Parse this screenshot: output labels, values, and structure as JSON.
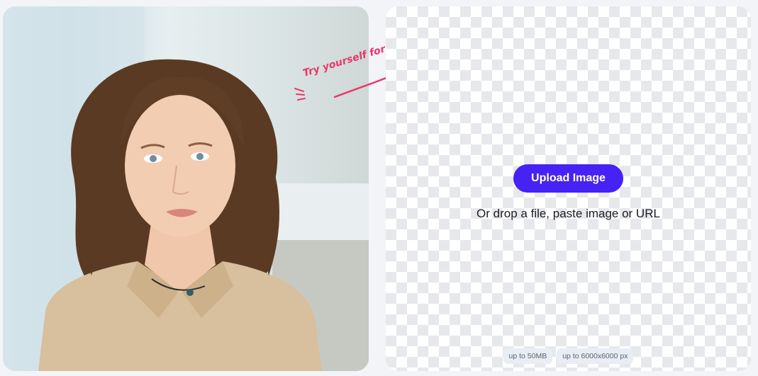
{
  "hero": {
    "photo_alt": "Portrait of a young woman with curly brown hair in a beige shirt",
    "annotation_text": "Try yourself for free"
  },
  "upload": {
    "button_label": "Upload Image",
    "drop_text": "Or drop a file, paste image or URL",
    "limits": [
      "up to 50MB",
      "up to 6000x6000 px"
    ]
  },
  "colors": {
    "accent": "#4622f5",
    "annotation": "#e8376b",
    "checker": "#e7e8ec"
  }
}
